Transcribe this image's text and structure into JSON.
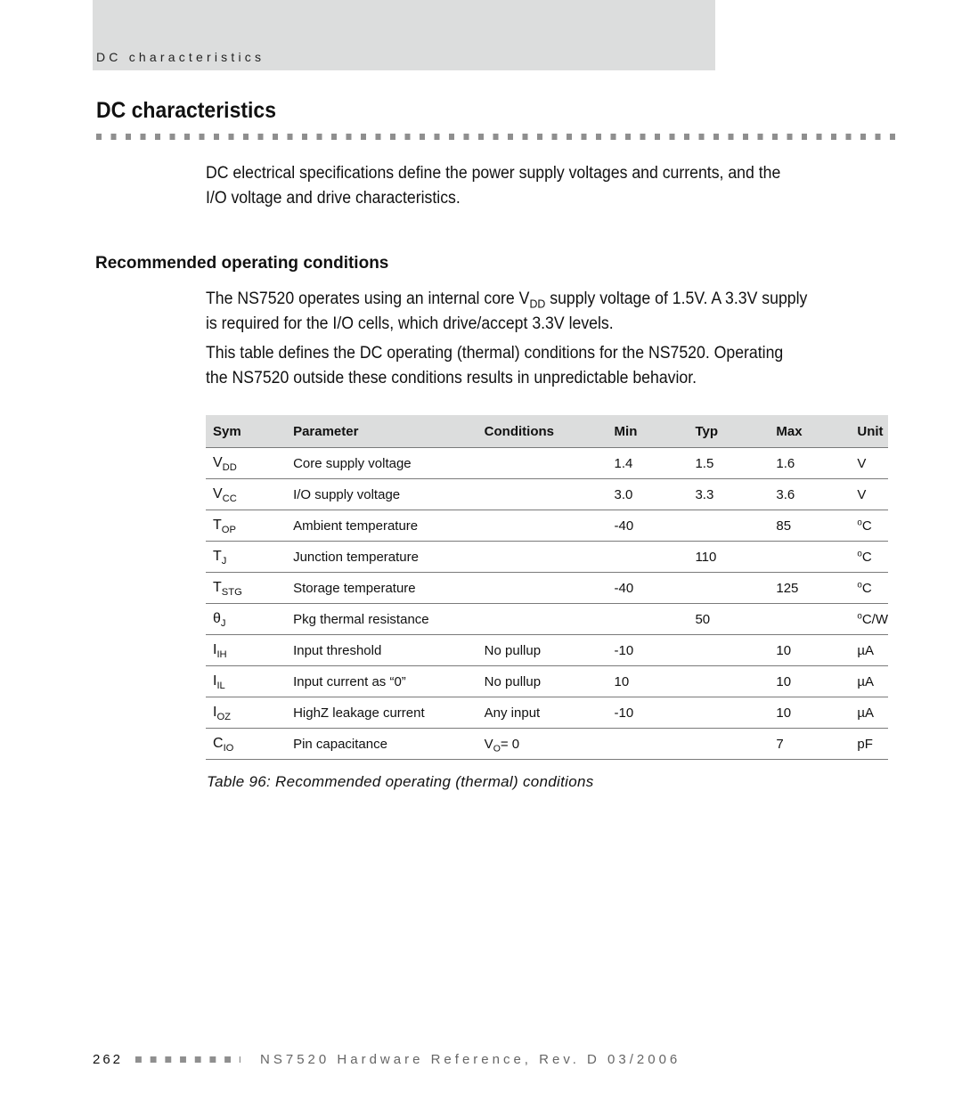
{
  "header": {
    "running_title": "DC characteristics"
  },
  "page_title": "DC characteristics",
  "intro": {
    "line1": "DC electrical specifications define the power supply voltages and currents, and the",
    "line2": "I/O voltage and drive characteristics."
  },
  "section": {
    "heading": "Recommended operating conditions",
    "para1": {
      "prefix": "The NS7520 operates using an internal core V",
      "sub": "DD",
      "suffix": " supply voltage of 1.5V. A 3.3V supply",
      "line2": "is required for the I/O cells, which drive/accept 3.3V levels."
    },
    "para2": {
      "line1": "This table defines the DC operating (thermal) conditions for the NS7520. Operating",
      "line2": "the NS7520 outside these conditions results in unpredictable behavior."
    }
  },
  "table": {
    "headers": [
      "Sym",
      "Parameter",
      "Conditions",
      "Min",
      "Typ",
      "Max",
      "Unit"
    ],
    "rows": [
      {
        "sym": "V",
        "sym_sub": "DD",
        "parameter": "Core supply voltage",
        "conditions": "",
        "cond_sub": "",
        "cond_tail": "",
        "min": "1.4",
        "typ": "1.5",
        "max": "1.6",
        "unit_sup": "",
        "unit": "V"
      },
      {
        "sym": "V",
        "sym_sub": "CC",
        "parameter": "I/O supply voltage",
        "conditions": "",
        "cond_sub": "",
        "cond_tail": "",
        "min": "3.0",
        "typ": "3.3",
        "max": "3.6",
        "unit_sup": "",
        "unit": "V"
      },
      {
        "sym": "T",
        "sym_sub": "OP",
        "parameter": "Ambient temperature",
        "conditions": "",
        "cond_sub": "",
        "cond_tail": "",
        "min": "-40",
        "typ": "",
        "max": "85",
        "unit_sup": "o",
        "unit": "C"
      },
      {
        "sym": "T",
        "sym_sub": "J",
        "parameter": "Junction temperature",
        "conditions": "",
        "cond_sub": "",
        "cond_tail": "",
        "min": "",
        "typ": "110",
        "max": "",
        "unit_sup": "o",
        "unit": "C"
      },
      {
        "sym": "T",
        "sym_sub": "STG",
        "parameter": "Storage temperature",
        "conditions": "",
        "cond_sub": "",
        "cond_tail": "",
        "min": "-40",
        "typ": "",
        "max": "125",
        "unit_sup": "o",
        "unit": "C"
      },
      {
        "sym": "θ",
        "sym_sub": "J",
        "parameter": "Pkg thermal resistance",
        "conditions": "",
        "cond_sub": "",
        "cond_tail": "",
        "min": "",
        "typ": "50",
        "max": "",
        "unit_sup": "o",
        "unit": "C/W"
      },
      {
        "sym": "I",
        "sym_sub": "IH",
        "parameter": "Input threshold",
        "conditions": "No pullup",
        "cond_sub": "",
        "cond_tail": "",
        "min": "-10",
        "typ": "",
        "max": "10",
        "unit_sup": "",
        "unit": "µA"
      },
      {
        "sym": "I",
        "sym_sub": "IL",
        "parameter": "Input current as “0”",
        "conditions": "No pullup",
        "cond_sub": "",
        "cond_tail": "",
        "min": "10",
        "typ": "",
        "max": "10",
        "unit_sup": "",
        "unit": "µA"
      },
      {
        "sym": "I",
        "sym_sub": "OZ",
        "parameter": "HighZ leakage current",
        "conditions": "Any input",
        "cond_sub": "",
        "cond_tail": "",
        "min": "-10",
        "typ": "",
        "max": "10",
        "unit_sup": "",
        "unit": "µA"
      },
      {
        "sym": "C",
        "sym_sub": "IO",
        "parameter": "Pin capacitance",
        "conditions": "V",
        "cond_sub": "O",
        "cond_tail": "= 0",
        "min": "",
        "typ": "",
        "max": "7",
        "unit_sup": "",
        "unit": "pF"
      }
    ],
    "caption": "Table 96: Recommended operating (thermal) conditions"
  },
  "footer": {
    "page_number": "262",
    "document": "NS7520 Hardware Reference, Rev. D  03/2006"
  }
}
